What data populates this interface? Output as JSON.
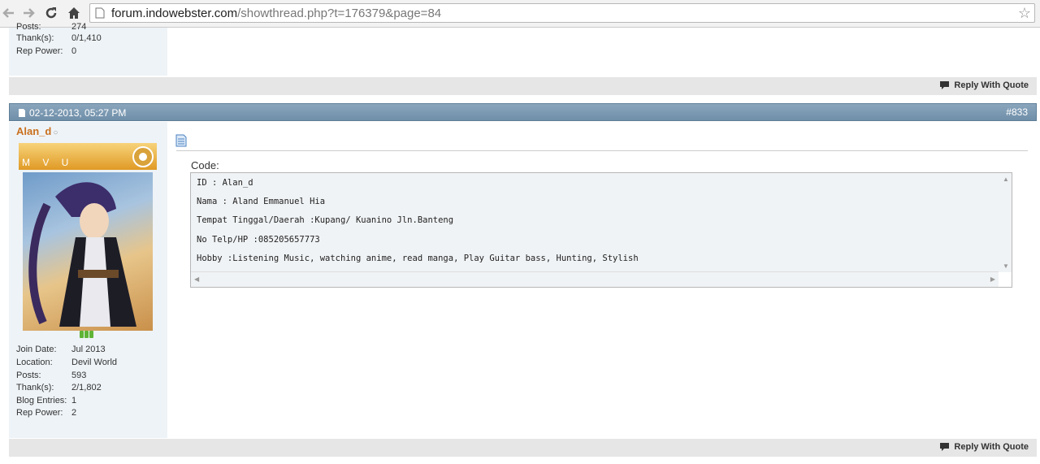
{
  "browser": {
    "url_domain": "forum.indowebster.com",
    "url_path": "/showthread.php?t=176379&page=84",
    "icons": [
      "back-icon",
      "forward-icon",
      "reload-icon",
      "home-icon",
      "page-icon",
      "bookmark-star-icon"
    ]
  },
  "prev_post": {
    "posts_label": "Posts:",
    "posts_value": "274",
    "thanks_label": "Thank(s):",
    "thanks_value": "0/1,410",
    "rep_label": "Rep Power:",
    "rep_value": "0",
    "reply_label": "Reply With Quote"
  },
  "post": {
    "date": "02-12-2013, 05:27 PM",
    "number": "#833",
    "username": "Alan_d",
    "status_icon": "offline-dot-icon",
    "rank_banner": "M V U",
    "info": [
      {
        "label": "Join Date:",
        "value": "Jul 2013"
      },
      {
        "label": "Location:",
        "value": "Devil World"
      },
      {
        "label": "Posts:",
        "value": "593"
      },
      {
        "label": "Thank(s):",
        "value": "2/1,802"
      },
      {
        "label": "Blog Entries:",
        "value": "1"
      },
      {
        "label": "Rep Power:",
        "value": "2"
      }
    ],
    "code_label": "Code:",
    "code_lines": [
      "ID : Alan_d",
      "Nama : Aland Emmanuel Hia",
      "Tempat Tinggal/Daerah :Kupang/ Kuanino Jln.Banteng",
      "No Telp/HP :085205657773",
      "Hobby :Listening Music, watching anime, read manga, Play Guitar bass, Hunting, Stylish"
    ],
    "reply_label": "Reply With Quote"
  },
  "colors": {
    "header_bar": "#7a97b0",
    "username": "#c9701e",
    "sidebar_bg": "#eef3f7",
    "rep_green": "#5fb436"
  }
}
